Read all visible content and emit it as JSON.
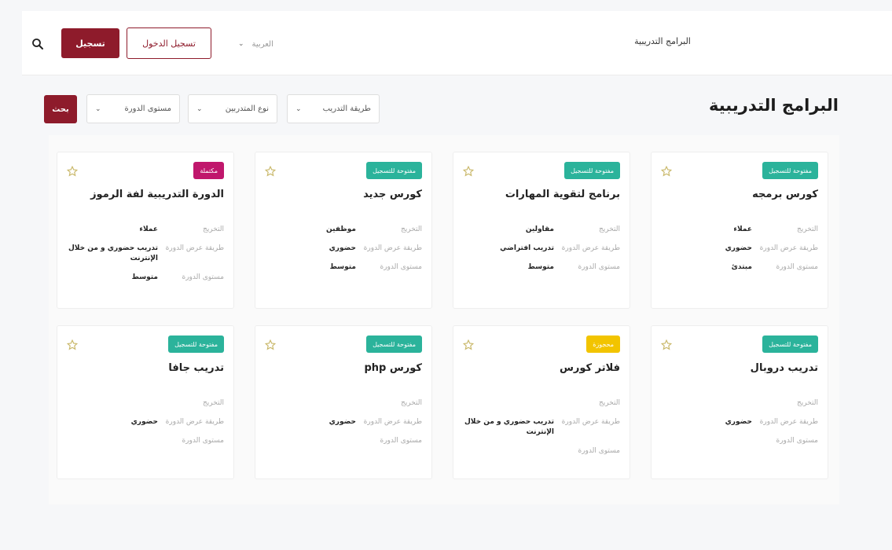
{
  "header": {
    "nav_link": "البرامج التدريبية",
    "language": "العربية",
    "login_label": "تسجيل الدخول",
    "register_label": "تسجيل"
  },
  "page": {
    "title": "البرامج التدريبية"
  },
  "filters": {
    "method": "طريقة التدريب",
    "trainer_type": "نوع المتدربين",
    "level": "مستوى الدورة",
    "search_label": "بحث"
  },
  "colors": {
    "primary": "#8e1b2b",
    "badge_teal": "#2bb39b",
    "badge_magenta": "#c0176c",
    "badge_yellow": "#f2c400"
  },
  "labels": {
    "audience": "التخريج",
    "method": "طريقة عرض الدورة",
    "level": "مستوى الدورة"
  },
  "courses": [
    {
      "badge": "مفتوحة للتسجيل",
      "badge_color": "teal",
      "title": "كورس برمجه",
      "audience": "عملاء",
      "method": "حضوري",
      "level": "مبتدئ"
    },
    {
      "badge": "مفتوحة للتسجيل",
      "badge_color": "teal",
      "title": "برنامج لتقوية المهارات",
      "audience": "مقاولين",
      "method": "تدريب افتراضي",
      "level": "متوسط"
    },
    {
      "badge": "مفتوحة للتسجيل",
      "badge_color": "teal",
      "title": "كورس جديد",
      "audience": "موظفين",
      "method": "حضوري",
      "level": "متوسط"
    },
    {
      "badge": "مكتملة",
      "badge_color": "magenta",
      "title": "الدورة التدريبية لفة الرموز",
      "audience": "عملاء",
      "method": "تدريب حضوري و من خلال الإنترنت",
      "level": "متوسط"
    },
    {
      "badge": "مفتوحة للتسجيل",
      "badge_color": "teal",
      "title": "تدريب دروبال",
      "audience": "",
      "method": "حضوري",
      "level": ""
    },
    {
      "badge": "محجوزة",
      "badge_color": "yellow",
      "title": "فلاتر كورس",
      "audience": "",
      "method": "تدريب حضوري و من خلال الإنترنت",
      "level": ""
    },
    {
      "badge": "مفتوحة للتسجيل",
      "badge_color": "teal",
      "title": "كورس php",
      "audience": "",
      "method": "حضوري",
      "level": ""
    },
    {
      "badge": "مفتوحة للتسجيل",
      "badge_color": "teal",
      "title": "تدريب جافا",
      "audience": "",
      "method": "حضوري",
      "level": ""
    }
  ]
}
